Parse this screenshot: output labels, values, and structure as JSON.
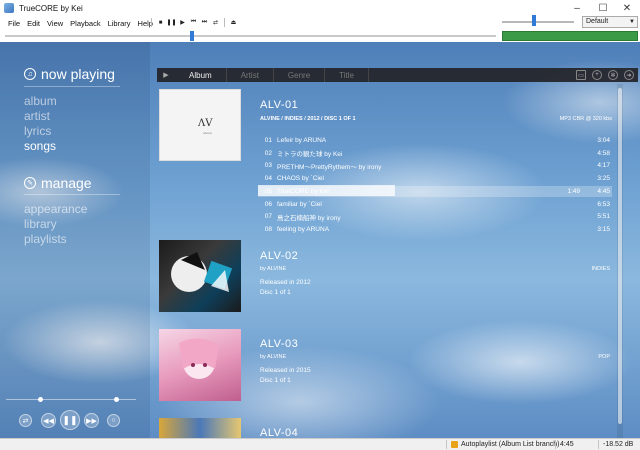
{
  "window": {
    "title": "TrueCORE by Kei",
    "min": "–",
    "max": "☐",
    "close": "✕"
  },
  "menu": [
    "File",
    "Edit",
    "View",
    "Playback",
    "Library",
    "Help"
  ],
  "transport": [
    "■",
    "❚❚",
    "▶",
    "⏮",
    "⏭",
    "⇄",
    "⏏"
  ],
  "output": {
    "selected": "Default"
  },
  "seek_position": 0.38,
  "volume_level": 0.45,
  "nav": {
    "now_playing": "now playing",
    "items": [
      "album",
      "artist",
      "lyrics",
      "songs"
    ],
    "manage": "manage",
    "manage_items": [
      "appearance",
      "library",
      "playlists"
    ]
  },
  "tabs": [
    "Album",
    "Artist",
    "Genre",
    "Title"
  ],
  "albums": [
    {
      "title": "ALV-01",
      "meta": "ALVINE / INDIES / 2012 / DISC 1 OF 1",
      "format": "MP3 CBR @ 320 kbs",
      "tracks": [
        {
          "n": "01",
          "title": "Lefeir by ARUNA",
          "dur": "3:04"
        },
        {
          "n": "02",
          "title": "ミトラの観た球 by Kei",
          "dur": "4:58"
        },
        {
          "n": "03",
          "title": "PRETHM～PrettyRythem～ by irony",
          "dur": "4:17"
        },
        {
          "n": "04",
          "title": "CHAOS by `Ciel",
          "dur": "3:25"
        },
        {
          "n": "05",
          "title": "TrueCORE by Kei",
          "dur": "4:45",
          "elapsed": "1:49"
        },
        {
          "n": "06",
          "title": "familiar by `Ciel",
          "dur": "6:53"
        },
        {
          "n": "07",
          "title": "鳥之石楠船神 by irony",
          "dur": "5:51"
        },
        {
          "n": "08",
          "title": "feeling by ARUNA",
          "dur": "3:15"
        }
      ]
    },
    {
      "title": "ALV-02",
      "artist": "by ALVINE",
      "genre": "INDIES",
      "released": "Released in 2012",
      "disc": "Disc 1 of 1"
    },
    {
      "title": "ALV-03",
      "artist": "by ALVINE",
      "genre": "POP",
      "released": "Released in 2015",
      "disc": "Disc 1 of 1"
    },
    {
      "title": "ALV-04"
    }
  ],
  "status": {
    "playlist": "Autoplaylist (Album List branch)",
    "time": "4:45",
    "db": "-18.52 dB"
  },
  "colors": {
    "accent": "#2f7ad6",
    "vu": "#3a9a45",
    "sky": "#6ea1d2"
  }
}
